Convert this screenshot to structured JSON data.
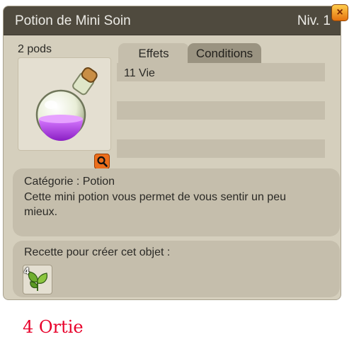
{
  "window": {
    "title": "Potion de Mini Soin",
    "level": "Niv. 1",
    "close_icon": "×"
  },
  "item": {
    "weight": "2 pods",
    "icon": "potion-icon",
    "potion_color": "#b03ce8"
  },
  "tabs": [
    {
      "label": "Effets",
      "active": true
    },
    {
      "label": "Conditions",
      "active": false
    }
  ],
  "effects": [
    "11 Vie"
  ],
  "details": {
    "category": "Catégorie : Potion",
    "description": "Cette mini potion vous permet de vous sentir un peu mieux."
  },
  "recipe": {
    "title": "Recette pour créer cet objet :",
    "ingredients": [
      {
        "quantity": "4",
        "icon": "nettle-leaf-icon"
      }
    ]
  },
  "caption": "4 Ortie",
  "colors": {
    "title_bar": "#4f4a3e",
    "panel": "#d5cfbd",
    "accent_orange": "#ec6e1c",
    "caption_red": "#e8002a"
  }
}
